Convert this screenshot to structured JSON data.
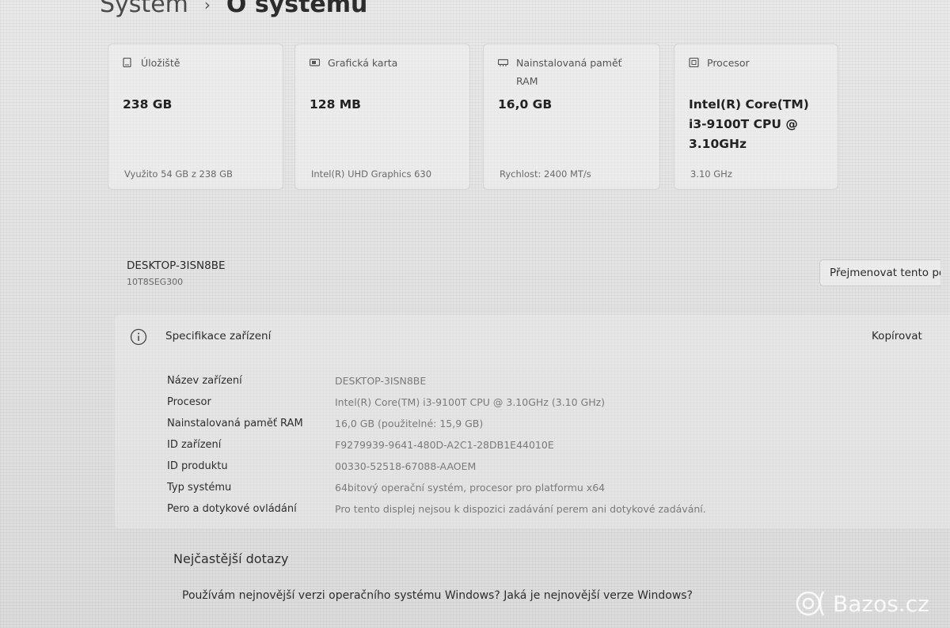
{
  "breadcrumb": {
    "parent": "Systém",
    "separator": "›",
    "current": "O systému"
  },
  "cards": [
    {
      "label": "Úložiště",
      "value": "238 GB",
      "sub": "Využito 54 GB z 238 GB",
      "icon": "storage-icon"
    },
    {
      "label": "Grafická karta",
      "value": "128 MB",
      "sub": "Intel(R) UHD Graphics 630",
      "icon": "graphics-card-icon"
    },
    {
      "label": "Nainstalovaná paměť RAM",
      "value": "16,0 GB",
      "sub": "Rychlost: 2400 MT/s",
      "icon": "memory-icon"
    },
    {
      "label": "Procesor",
      "value": "Intel(R) Core(TM) i3-9100T CPU @ 3.10GHz",
      "sub": "3.10 GHz",
      "icon": "processor-icon"
    }
  ],
  "device": {
    "name": "DESKTOP-3ISN8BE",
    "model": "10T8SEG300",
    "rename_label": "Přejmenovat tento po"
  },
  "specs": {
    "title": "Specifikace zařízení",
    "copy_label": "Kopírovat",
    "rows": [
      {
        "label": "Název zařízení",
        "value": "DESKTOP-3ISN8BE"
      },
      {
        "label": "Procesor",
        "value": "Intel(R) Core(TM) i3-9100T CPU @ 3.10GHz (3.10 GHz)"
      },
      {
        "label": "Nainstalovaná paměť RAM",
        "value": "16,0 GB (použitelné: 15,9 GB)"
      },
      {
        "label": "ID zařízení",
        "value": "F9279939-9641-480D-A2C1-28DB1E44010E"
      },
      {
        "label": "ID produktu",
        "value": "00330-52518-67088-AAOEM"
      },
      {
        "label": "Typ systému",
        "value": "64bitový operační systém, procesor pro platformu x64"
      },
      {
        "label": "Pero a dotykové ovládání",
        "value": "Pro tento displej nejsou k dispozici zadávání perem ani dotykové zadávání."
      }
    ]
  },
  "faq": {
    "title": "Nejčastější dotazy",
    "question": "Používám nejnovější verzi operačního systému Windows? Jaká je nejnovější verze Windows?"
  },
  "watermark": {
    "text": "Bazos.cz",
    "icon": "bazos-logo-icon"
  }
}
